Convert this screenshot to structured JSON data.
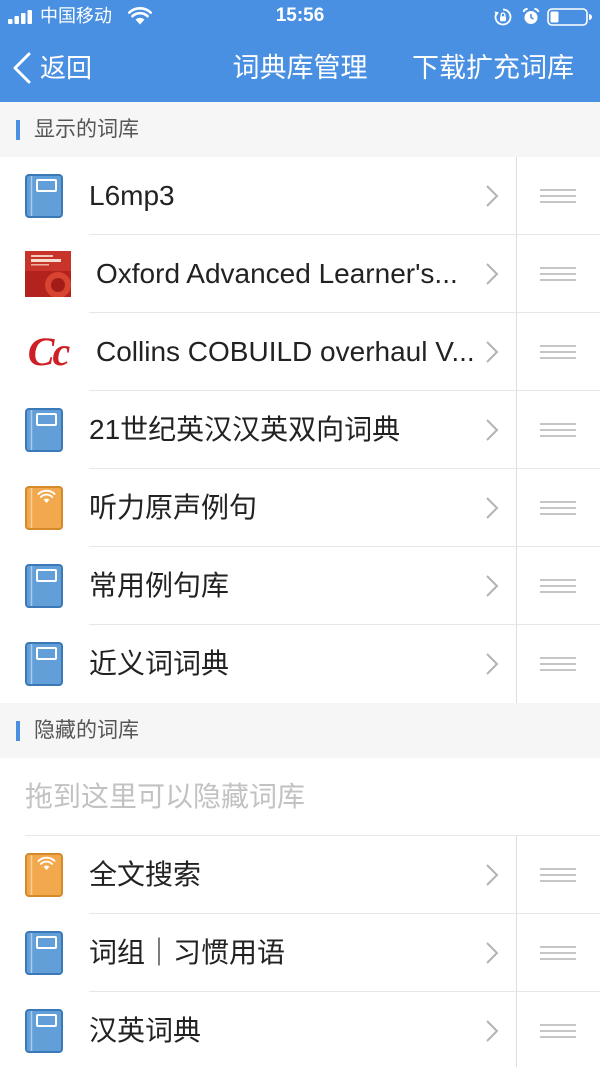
{
  "status_bar": {
    "carrier": "中国移动",
    "time": "15:56",
    "icons": [
      "signal-icon",
      "wifi-icon",
      "rotation-lock-icon",
      "alarm-icon",
      "battery-icon"
    ]
  },
  "nav": {
    "back_label": "返回",
    "title": "词典库管理",
    "download_label": "下载扩充词库"
  },
  "shown_section": {
    "title": "显示的词库",
    "items": [
      {
        "name": "L6mp3",
        "icon": "blue-book-icon"
      },
      {
        "name": "Oxford Advanced Learner's...",
        "icon": "oxford-cover-icon"
      },
      {
        "name": "Collins COBUILD overhaul V...",
        "icon": "collins-logo-icon",
        "logo_text": "Cc"
      },
      {
        "name": "21世纪英汉汉英双向词典",
        "icon": "blue-book-icon"
      },
      {
        "name": "听力原声例句",
        "icon": "orange-audio-book-icon"
      },
      {
        "name": "常用例句库",
        "icon": "blue-book-icon"
      },
      {
        "name": "近义词词典",
        "icon": "blue-book-icon"
      }
    ]
  },
  "hidden_section": {
    "title": "隐藏的词库",
    "drop_hint": "拖到这里可以隐藏词库",
    "items": [
      {
        "name": "全文搜索",
        "icon": "orange-audio-book-icon"
      },
      {
        "name": "词组｜习惯用语",
        "icon": "blue-book-icon"
      },
      {
        "name": "汉英词典",
        "icon": "blue-book-icon"
      }
    ]
  },
  "colors": {
    "accent": "#4a90e2",
    "blue_book": "#629fd9",
    "orange_book": "#f2a94e",
    "collins_red": "#cf1f26",
    "text": "#222222",
    "hint_text": "#c2c2c2"
  }
}
